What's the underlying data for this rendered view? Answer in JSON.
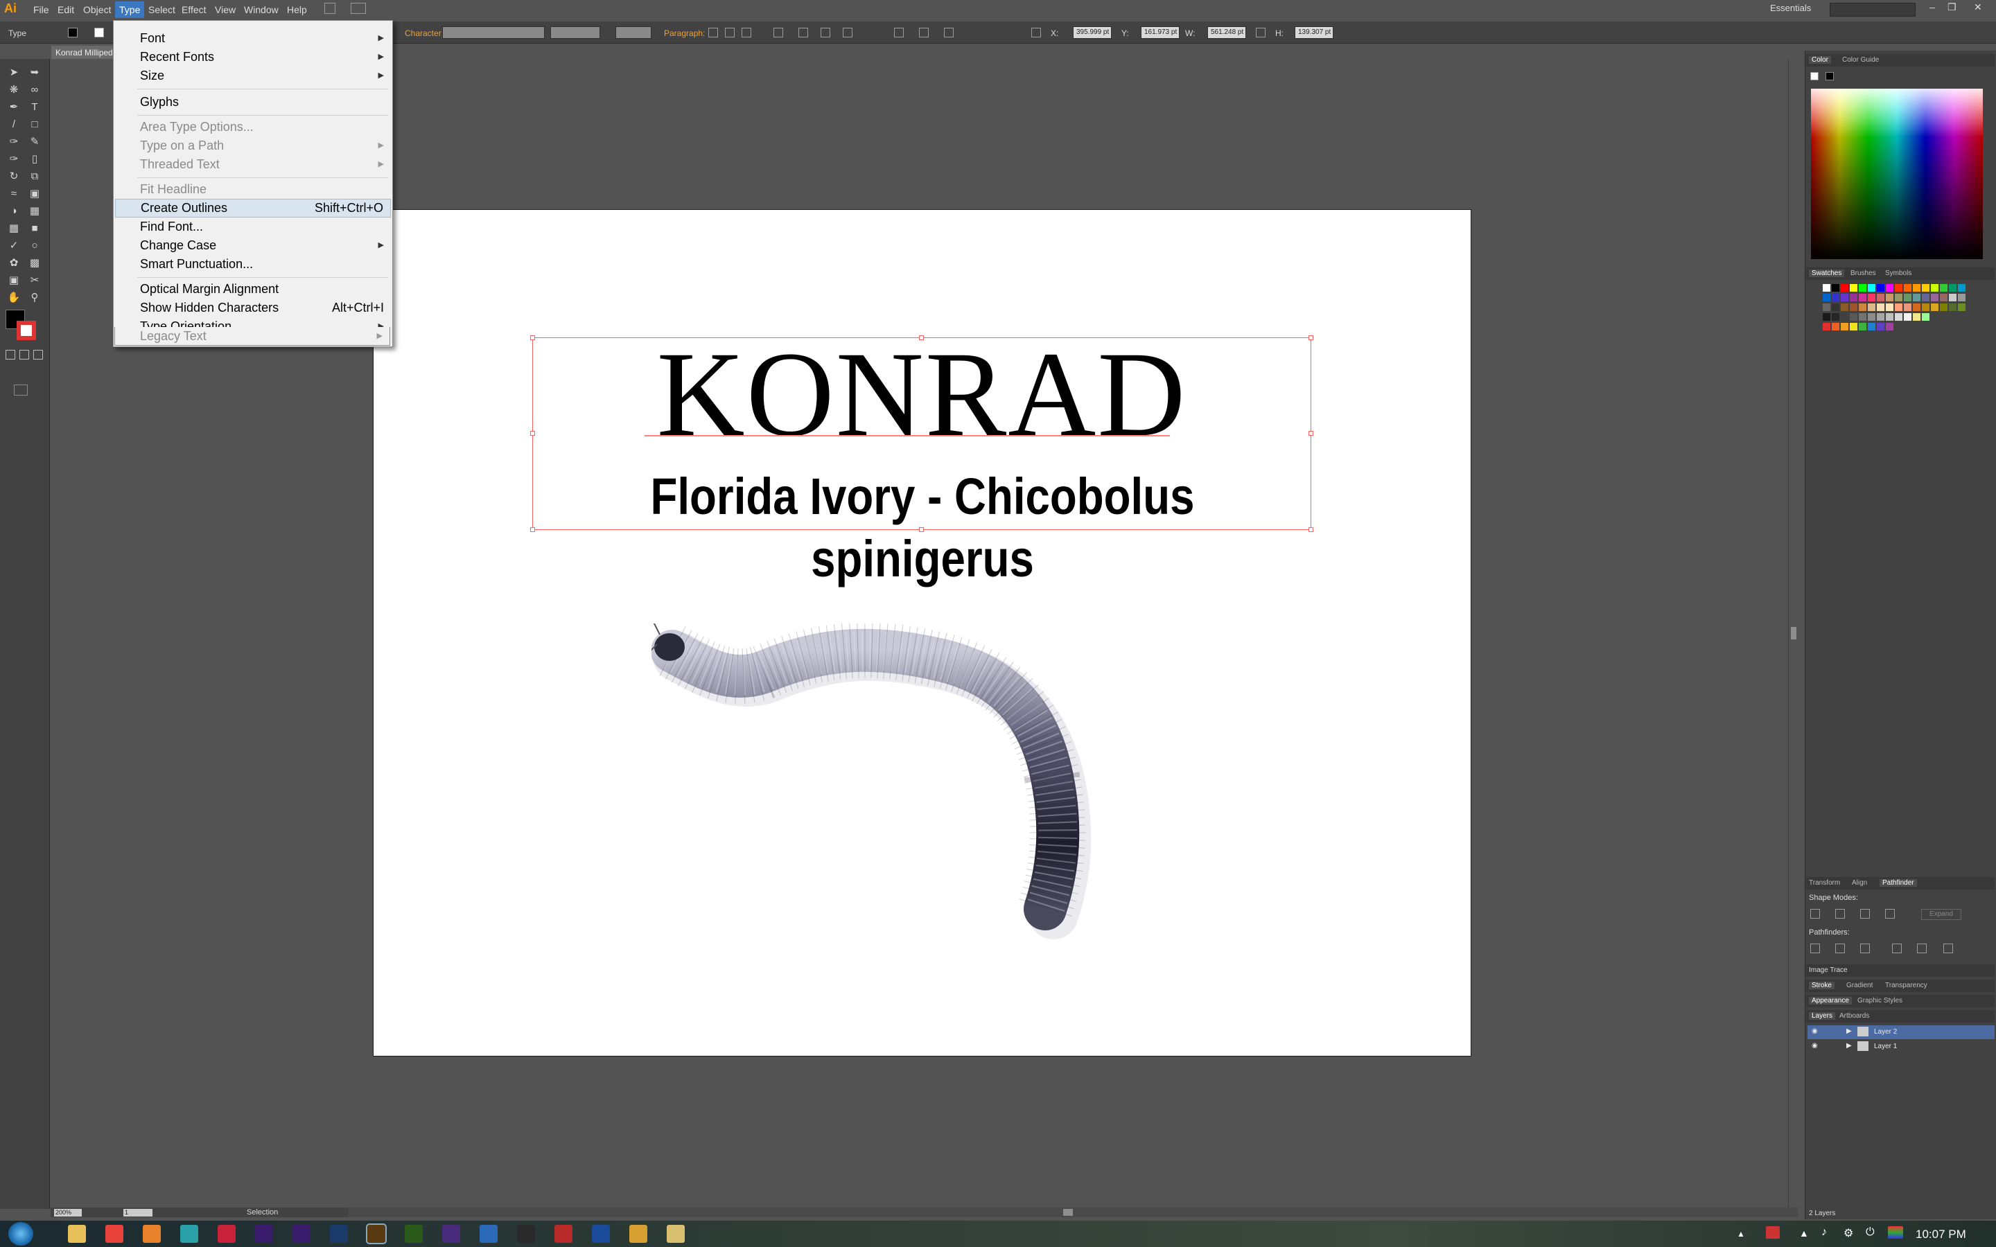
{
  "menubar": {
    "logo": "Ai",
    "items": [
      "File",
      "Edit",
      "Object",
      "Type",
      "Select",
      "Effect",
      "View",
      "Window",
      "Help"
    ],
    "workspace": "Essentials"
  },
  "control_bar": {
    "tool_label": "Type",
    "character_label": "Character:",
    "paragraph_label": "Paragraph:",
    "x_label": "X:",
    "x_value": "395.999 pt",
    "y_label": "Y:",
    "y_value": "161.973 pt",
    "w_label": "W:",
    "w_value": "561.248 pt",
    "h_label": "H:",
    "h_value": "139.307 pt"
  },
  "document": {
    "tab_title": "Konrad Millipede"
  },
  "artboard": {
    "title": "KONRAD",
    "subtitle": "Florida Ivory - Chicobolus spinigerus",
    "image_label": "millipede illustration"
  },
  "status": {
    "zoom": "200%",
    "page": "1",
    "tool": "Selection"
  },
  "type_menu": {
    "items": [
      {
        "label": "Font",
        "submenu": true,
        "disabled": false
      },
      {
        "label": "Recent Fonts",
        "submenu": true,
        "disabled": false
      },
      {
        "label": "Size",
        "submenu": true,
        "disabled": false
      },
      {
        "label": "Glyphs",
        "submenu": false,
        "disabled": false
      },
      {
        "label": "Area Type Options...",
        "submenu": false,
        "disabled": true
      },
      {
        "label": "Type on a Path",
        "submenu": true,
        "disabled": true
      },
      {
        "label": "Threaded Text",
        "submenu": true,
        "disabled": true
      },
      {
        "label": "Fit Headline",
        "submenu": false,
        "disabled": true
      },
      {
        "label": "Create Outlines",
        "shortcut": "Shift+Ctrl+O",
        "submenu": false,
        "disabled": false
      },
      {
        "label": "Find Font...",
        "submenu": false,
        "disabled": false
      },
      {
        "label": "Change Case",
        "submenu": true,
        "disabled": false
      },
      {
        "label": "Smart Punctuation...",
        "submenu": false,
        "disabled": false
      },
      {
        "label": "Optical Margin Alignment",
        "submenu": false,
        "disabled": false
      },
      {
        "label": "Show Hidden Characters",
        "shortcut": "Alt+Ctrl+I",
        "submenu": false,
        "disabled": false
      },
      {
        "label": "Type Orientation",
        "submenu": true,
        "disabled": false
      },
      {
        "label": "Legacy Text",
        "submenu": true,
        "disabled": true
      }
    ]
  },
  "panels": {
    "color_tabs": [
      "Color",
      "Color Guide"
    ],
    "swatch_tabs": [
      "Swatches",
      "Brushes",
      "Symbols"
    ],
    "transform_tabs": [
      "Transform",
      "Align",
      "Pathfinder"
    ],
    "shape_modes_label": "Shape Modes:",
    "expand_label": "Expand",
    "pathfinders_label": "Pathfinders:",
    "image_trace": "Image Trace",
    "stroke_tabs": [
      "Stroke",
      "Gradient",
      "Transparency"
    ],
    "appearance_tabs": [
      "Appearance",
      "Graphic Styles"
    ],
    "layers_tabs": [
      "Layers",
      "Artboards"
    ],
    "layers": [
      "Layer 2",
      "Layer 1"
    ],
    "layers_count": "2 Layers"
  },
  "taskbar": {
    "time": "10:07 PM",
    "apps": [
      "Explorer",
      "Chrome",
      "Firefox",
      "Arduino",
      "Flash",
      "Ae",
      "Pr",
      "Ps",
      "Ai",
      "Dw",
      "Premiere",
      "Autodesk",
      "P",
      "M",
      "W",
      "Pen",
      "Notes"
    ]
  },
  "colors": {
    "menu_highlight": "#3a78c2",
    "selection_box": "#ff5f5f",
    "app_bg": "#535353",
    "panel_bg": "#424242"
  }
}
